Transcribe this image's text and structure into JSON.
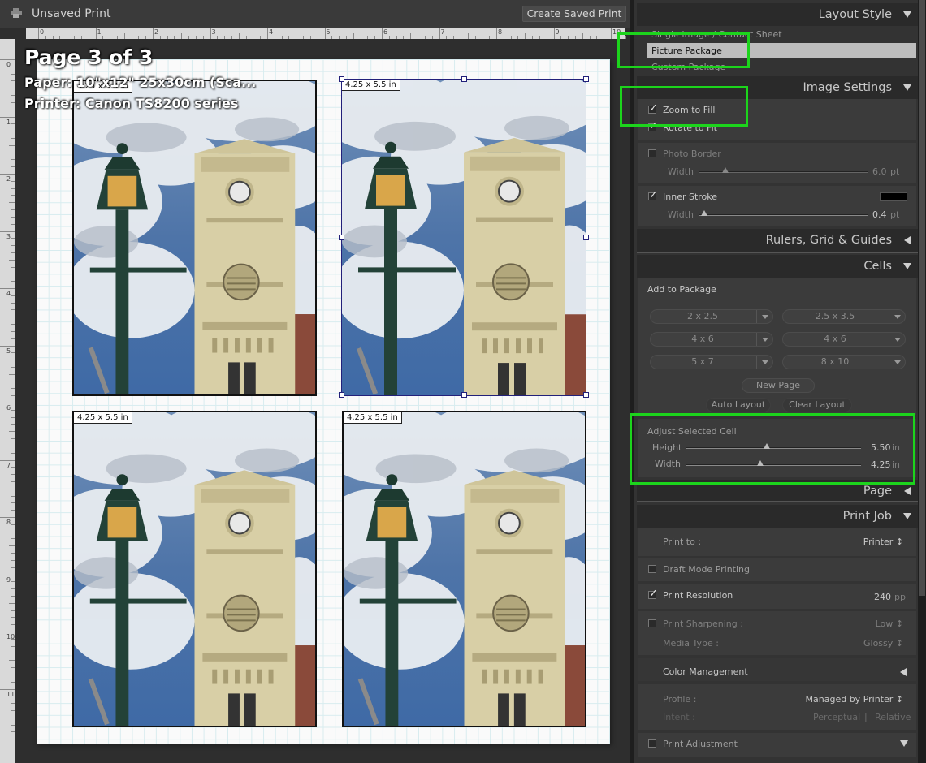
{
  "window": {
    "title": "Unsaved Print",
    "create_saved_print": "Create Saved Print"
  },
  "ruler": {
    "top_numbers": [
      "0",
      "1",
      "2",
      "3",
      "4",
      "5",
      "6",
      "7",
      "8",
      "9",
      "10"
    ],
    "left_numbers": [
      "0",
      "1",
      "2",
      "3",
      "4",
      "5",
      "6",
      "7",
      "8",
      "9",
      "10",
      "11"
    ]
  },
  "overlay": {
    "page": "Page 3 of 3",
    "paper": "Paper:  10\"x12\" 25x30cm (Sca...",
    "printer": "Printer:  Canon TS8200 series"
  },
  "cells": [
    {
      "label": "4.25 x 5.5 in",
      "selected": false
    },
    {
      "label": "4.25 x 5.5 in",
      "selected": true
    },
    {
      "label": "4.25 x 5.5 in",
      "selected": false
    },
    {
      "label": "4.25 x 5.5 in",
      "selected": false
    }
  ],
  "layout_style": {
    "header": "Layout Style",
    "options": [
      "Single Image / Contact Sheet",
      "Picture Package",
      "Custom Package"
    ],
    "selected": "Picture Package"
  },
  "image_settings": {
    "header": "Image Settings",
    "zoom_to_fill": {
      "label": "Zoom to Fill",
      "checked": true
    },
    "rotate_to_fit": {
      "label": "Rotate to Fit",
      "checked": true
    },
    "photo_border": {
      "label": "Photo Border",
      "checked": false,
      "width_label": "Width",
      "width_value": "6.0",
      "unit": "pt"
    },
    "inner_stroke": {
      "label": "Inner Stroke",
      "checked": true,
      "width_label": "Width",
      "width_value": "0.4",
      "unit": "pt",
      "color": "#000000"
    }
  },
  "rulers_grid": {
    "header": "Rulers, Grid & Guides"
  },
  "cells_panel": {
    "header": "Cells",
    "add_to_package": "Add to Package",
    "sizes": [
      "2 x 2.5",
      "2.5 x 3.5",
      "4 x 6",
      "4 x 6",
      "5 x 7",
      "8 x 10"
    ],
    "new_page": "New Page",
    "auto_layout": "Auto Layout",
    "clear_layout": "Clear Layout",
    "adjust_selected_cell": "Adjust Selected Cell",
    "height_label": "Height",
    "height_value": "5.50",
    "width_label": "Width",
    "width_value": "4.25",
    "unit": "in"
  },
  "page_section": {
    "header": "Page"
  },
  "print_job": {
    "header": "Print Job",
    "print_to_label": "Print to :",
    "print_to_value": "Printer ↕",
    "draft_mode": {
      "label": "Draft Mode Printing",
      "checked": false
    },
    "print_resolution": {
      "label": "Print Resolution",
      "checked": true,
      "value": "240",
      "unit": "ppi"
    },
    "print_sharpening": {
      "label": "Print Sharpening :",
      "checked": false,
      "value": "Low ↕"
    },
    "media_type": {
      "label": "Media Type :",
      "value": "Glossy ↕"
    },
    "color_management": "Color Management",
    "profile_label": "Profile :",
    "profile_value": "Managed by Printer ↕",
    "intent_label": "Intent :",
    "intent_perceptual": "Perceptual",
    "intent_sep": "|",
    "intent_relative": "Relative",
    "print_adjustment": {
      "label": "Print Adjustment",
      "checked": false
    }
  },
  "colors": {
    "highlight": "#1cd41c",
    "selected_option_bg": "#bdbdbd",
    "panel_bg": "#333333"
  }
}
